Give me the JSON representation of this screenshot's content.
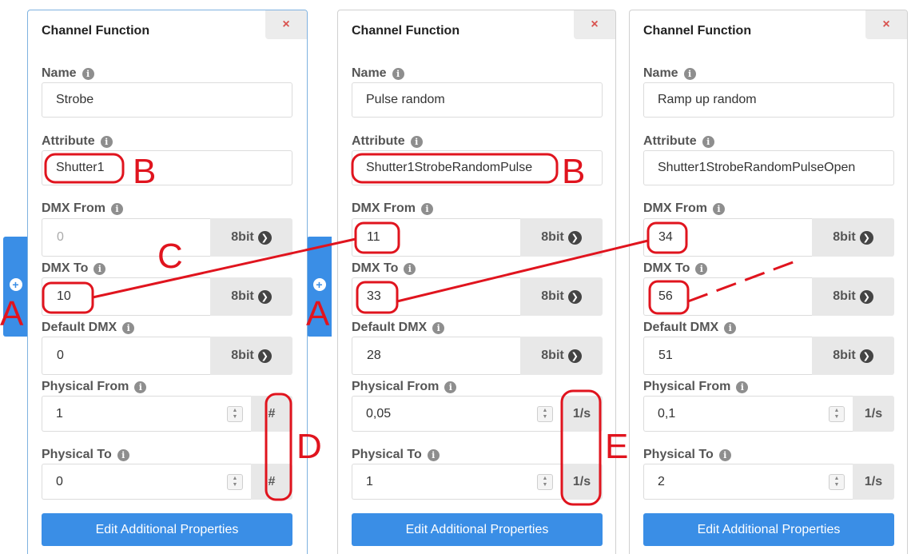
{
  "panels": [
    {
      "title": "Channel Function",
      "close": "×",
      "name_label": "Name",
      "name_value": "Strobe",
      "attribute_label": "Attribute",
      "attribute_value": "Shutter1",
      "dmx_from_label": "DMX From",
      "dmx_from_value": "0",
      "dmx_to_label": "DMX To",
      "dmx_to_value": "10",
      "default_dmx_label": "Default DMX",
      "default_dmx_value": "0",
      "bit_label": "8bit",
      "physical_from_label": "Physical From",
      "physical_from_value": "1",
      "physical_from_unit": "#",
      "physical_to_label": "Physical To",
      "physical_to_value": "0",
      "physical_to_unit": "#",
      "edit_button": "Edit Additional Properties"
    },
    {
      "title": "Channel Function",
      "close": "×",
      "name_label": "Name",
      "name_value": "Pulse random",
      "attribute_label": "Attribute",
      "attribute_value": "Shutter1StrobeRandomPulse",
      "dmx_from_label": "DMX From",
      "dmx_from_value": "11",
      "dmx_to_label": "DMX To",
      "dmx_to_value": "33",
      "default_dmx_label": "Default DMX",
      "default_dmx_value": "28",
      "bit_label": "8bit",
      "physical_from_label": "Physical From",
      "physical_from_value": "0,05",
      "physical_from_unit": "1/s",
      "physical_to_label": "Physical To",
      "physical_to_value": "1",
      "physical_to_unit": "1/s",
      "edit_button": "Edit Additional Properties"
    },
    {
      "title": "Channel Function",
      "close": "×",
      "name_label": "Name",
      "name_value": "Ramp up random",
      "attribute_label": "Attribute",
      "attribute_value": "Shutter1StrobeRandomPulseOpen",
      "dmx_from_label": "DMX From",
      "dmx_from_value": "34",
      "dmx_to_label": "DMX To",
      "dmx_to_value": "56",
      "default_dmx_label": "Default DMX",
      "default_dmx_value": "51",
      "bit_label": "8bit",
      "physical_from_label": "Physical From",
      "physical_from_value": "0,1",
      "physical_from_unit": "1/s",
      "physical_to_label": "Physical To",
      "physical_to_value": "2",
      "physical_to_unit": "1/s",
      "edit_button": "Edit Additional Properties"
    }
  ],
  "side_tabs": [
    {
      "icon": "add-circle-icon",
      "glyph": "+"
    },
    {
      "icon": "add-circle-icon",
      "glyph": "+"
    }
  ],
  "annotations": {
    "a": "A",
    "b": "B",
    "c": "C",
    "d": "D",
    "e": "E"
  },
  "colors": {
    "accent_blue": "#3a8ee6",
    "annotation_red": "#e0141e",
    "close_red": "#d9534f"
  }
}
